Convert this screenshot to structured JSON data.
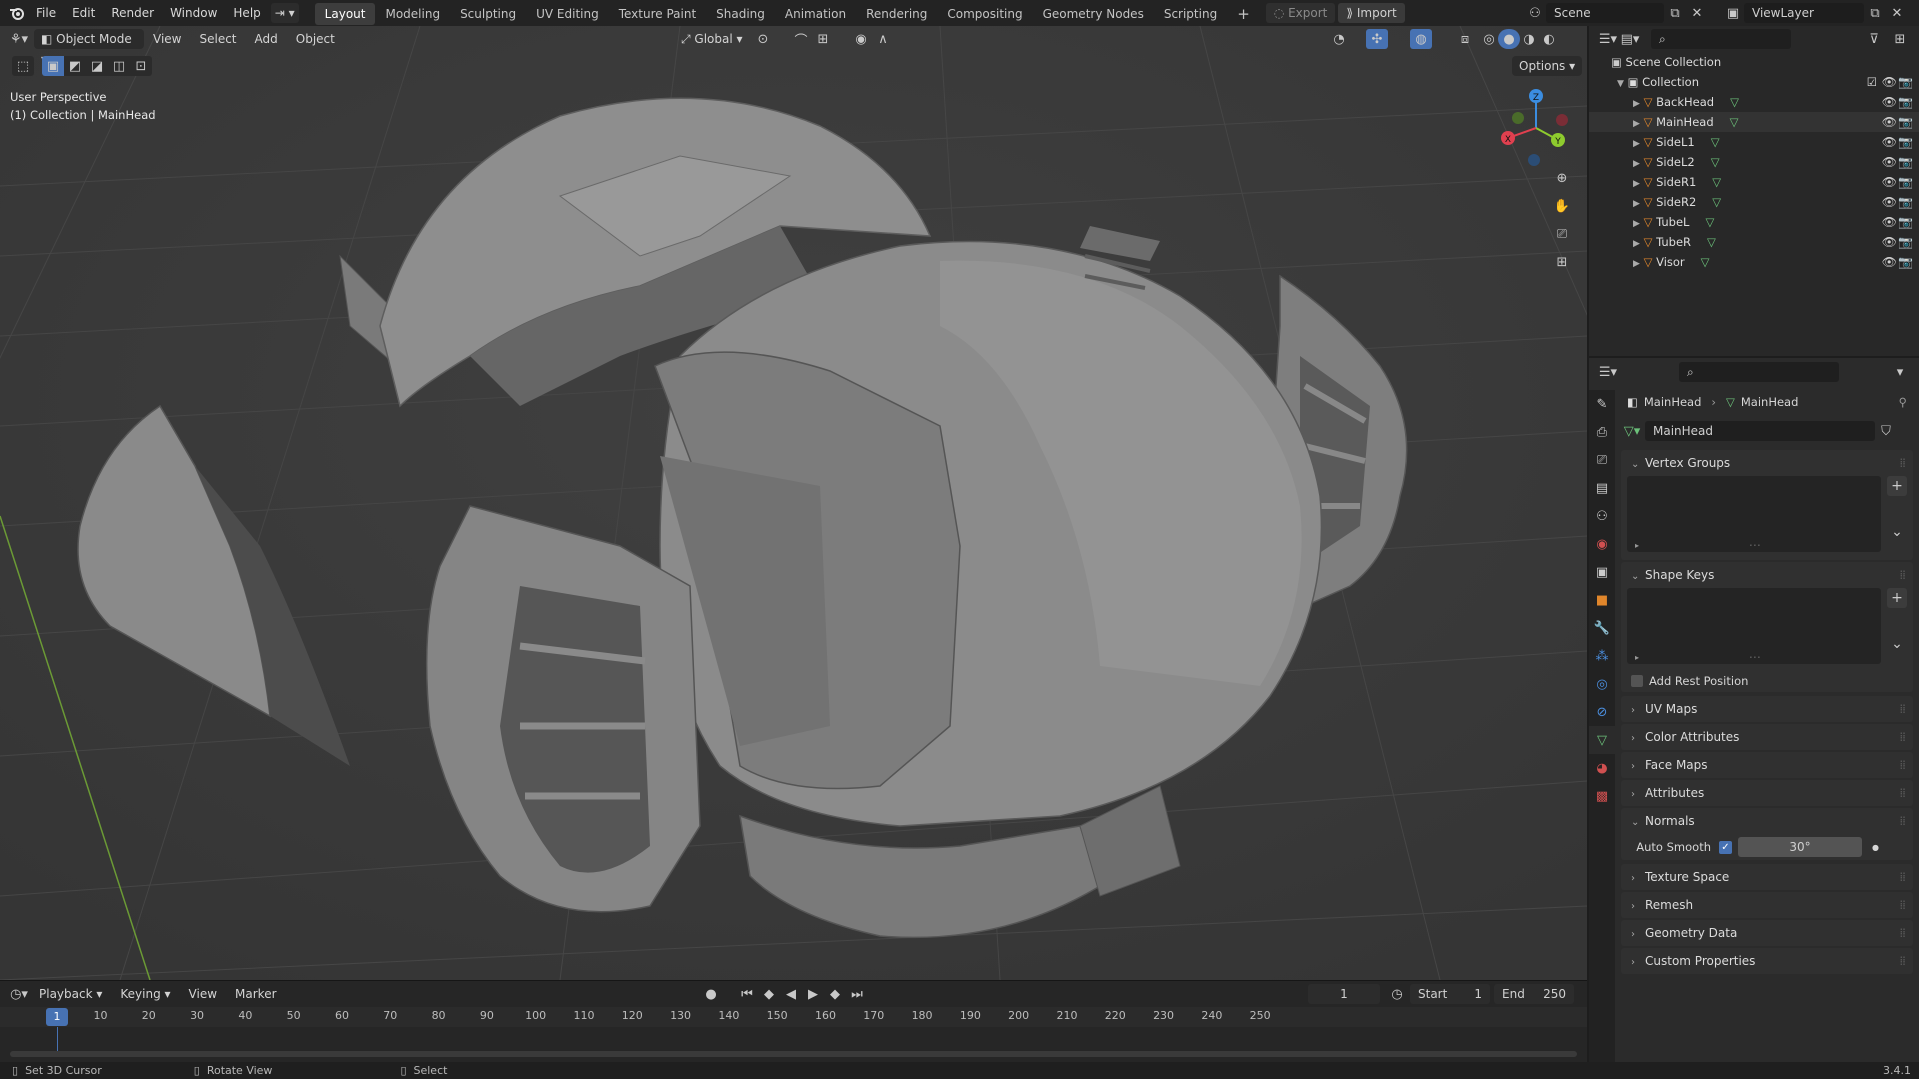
{
  "top_menu": [
    "File",
    "Edit",
    "Render",
    "Window",
    "Help"
  ],
  "workspaces": [
    "Layout",
    "Modeling",
    "Sculpting",
    "UV Editing",
    "Texture Paint",
    "Shading",
    "Animation",
    "Rendering",
    "Compositing",
    "Geometry Nodes",
    "Scripting"
  ],
  "active_workspace": "Layout",
  "top_right": {
    "export": "Export",
    "import": "Import",
    "scene": "Scene",
    "view_layer": "ViewLayer"
  },
  "viewport": {
    "mode": "Object Mode",
    "menus": [
      "View",
      "Select",
      "Add",
      "Object"
    ],
    "transform": "Global",
    "options": "Options",
    "overlay_line1": "User Perspective",
    "overlay_line2": "(1) Collection | MainHead",
    "gizmo": {
      "x": "X",
      "y": "Y",
      "z": "Z"
    }
  },
  "timeline": {
    "menus": [
      "Playback",
      "Keying",
      "View",
      "Marker"
    ],
    "current_frame": "1",
    "start_label": "Start",
    "start": "1",
    "end_label": "End",
    "end": "250",
    "ticks": [
      "1",
      "10",
      "20",
      "30",
      "40",
      "50",
      "60",
      "70",
      "80",
      "90",
      "100",
      "110",
      "120",
      "130",
      "140",
      "150",
      "160",
      "170",
      "180",
      "190",
      "200",
      "210",
      "220",
      "230",
      "240",
      "250"
    ]
  },
  "status": {
    "left": "Set 3D Cursor",
    "middle": "Rotate View",
    "right": "Select",
    "version": "3.4.1"
  },
  "outliner": {
    "root": "Scene Collection",
    "collection": "Collection",
    "objects": [
      "BackHead",
      "MainHead",
      "SideL1",
      "SideL2",
      "SideR1",
      "SideR2",
      "TubeL",
      "TubeR",
      "Visor"
    ],
    "selected": "MainHead"
  },
  "properties": {
    "breadcrumb_object": "MainHead",
    "breadcrumb_data": "MainHead",
    "data_name": "MainHead",
    "panels": {
      "vertex_groups": "Vertex Groups",
      "shape_keys": "Shape Keys",
      "add_rest_position": "Add Rest Position",
      "uv_maps": "UV Maps",
      "color_attributes": "Color Attributes",
      "face_maps": "Face Maps",
      "attributes": "Attributes",
      "normals": "Normals",
      "auto_smooth": "Auto Smooth",
      "auto_smooth_angle": "30°",
      "texture_space": "Texture Space",
      "remesh": "Remesh",
      "geometry_data": "Geometry Data",
      "custom_properties": "Custom Properties"
    }
  },
  "colors": {
    "accent": "#4772b3",
    "selection": "#2e4d7b",
    "orange": "#e0862b",
    "mesh_green": "#6cc17a",
    "axis_x": "#e0404f",
    "axis_y": "#8ecb2e",
    "axis_z": "#3b8de0"
  }
}
